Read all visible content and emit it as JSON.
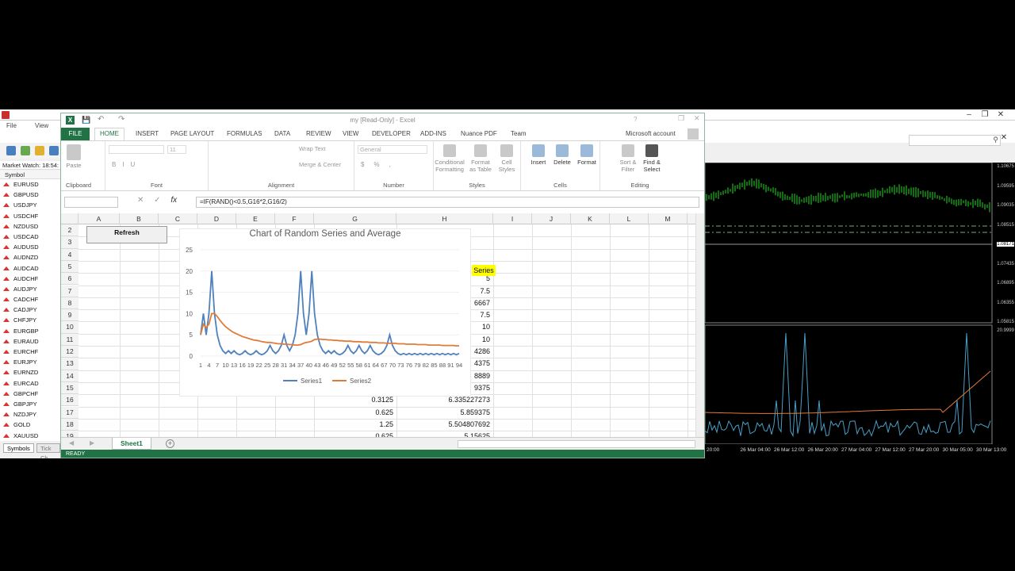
{
  "mt": {
    "menu": [
      "File",
      "View"
    ],
    "market_watch_header": "Market Watch: 18:54:",
    "symbol_col": "Symbol",
    "symbols": [
      "EURUSD",
      "GBPUSD",
      "USDJPY",
      "USDCHF",
      "NZDUSD",
      "USDCAD",
      "AUDUSD",
      "AUDNZD",
      "AUDCAD",
      "AUDCHF",
      "AUDJPY",
      "CADCHF",
      "CADJPY",
      "CHFJPY",
      "EURGBP",
      "EURAUD",
      "EURCHF",
      "EURJPY",
      "EURNZD",
      "EURCAD",
      "GBPCHF",
      "GBPJPY",
      "NZDJPY",
      "GOLD",
      "XAUUSD"
    ],
    "tabs": [
      "Symbols",
      "Tick Ch"
    ],
    "price_scale_top": [
      "1.10675",
      "1.09595",
      "1.09035",
      "1.08515",
      "1.08171",
      "1.07435",
      "1.06895",
      "1.06355",
      "1.05815"
    ],
    "price_scale_bottom": [
      "20.9999"
    ],
    "time_axis": [
      "20:00",
      "26 Mar 04:00",
      "26 Mar 12:00",
      "26 Mar 20:00",
      "27 Mar 04:00",
      "27 Mar 12:00",
      "27 Mar 20:00",
      "30 Mar 05:00",
      "30 Mar 13:00"
    ]
  },
  "excel": {
    "title": "my [Read-Only] - Excel",
    "account": "Microsoft account",
    "tabs": [
      "FILE",
      "HOME",
      "INSERT",
      "PAGE LAYOUT",
      "FORMULAS",
      "DATA",
      "REVIEW",
      "VIEW",
      "DEVELOPER",
      "ADD-INS",
      "Nuance PDF",
      "Team"
    ],
    "ribbon": {
      "clipboard": "Clipboard",
      "paste": "Paste",
      "font": "Font",
      "font_size": "11",
      "alignment": "Alignment",
      "wrap": "Wrap Text",
      "merge": "Merge & Center",
      "number": "Number",
      "number_format": "General",
      "styles": "Styles",
      "cond": "Conditional Formatting",
      "fmt_table": "Format as Table",
      "cell_styles": "Cell Styles",
      "cells": "Cells",
      "insert": "Insert",
      "delete": "Delete",
      "format": "Format",
      "editing": "Editing",
      "sort": "Sort & Filter",
      "find": "Find & Select"
    },
    "formula": "=IF(RAND()<0.5,G16*2,G16/2)",
    "columns": [
      "A",
      "B",
      "C",
      "D",
      "E",
      "F",
      "G",
      "H",
      "I",
      "J",
      "K",
      "L",
      "M"
    ],
    "rows": [
      "2",
      "3",
      "4",
      "5",
      "6",
      "7",
      "8",
      "9",
      "10",
      "11",
      "12",
      "13",
      "14",
      "15",
      "16",
      "17",
      "18",
      "19"
    ],
    "refresh_label": "Refresh",
    "series_header": "Series",
    "col_h_values": [
      "5",
      "7.5",
      "6667",
      "7.5",
      "10",
      "10",
      "4286",
      "4375",
      "8889",
      "9375",
      "6.335227273",
      "5.859375",
      "5.504807692",
      "5.15625"
    ],
    "col_g_values": [
      "0.3125",
      "0.625",
      "1.25",
      "0.625"
    ],
    "sheet_tab": "Sheet1",
    "status": "READY"
  },
  "chart_data": {
    "type": "line",
    "title": "Chart of Random Series and Average",
    "x_tick_labels": [
      "1",
      "4",
      "7",
      "10",
      "13",
      "16",
      "19",
      "22",
      "25",
      "28",
      "31",
      "34",
      "37",
      "40",
      "43",
      "46",
      "49",
      "52",
      "55",
      "58",
      "61",
      "64",
      "67",
      "70",
      "73",
      "76",
      "79",
      "82",
      "85",
      "88",
      "91",
      "94"
    ],
    "y_ticks": [
      "0",
      "5",
      "10",
      "15",
      "20",
      "25"
    ],
    "ylim": [
      0,
      25
    ],
    "series": [
      {
        "name": "Series1",
        "color": "#4f81bd",
        "values": [
          5,
          10,
          5,
          10,
          20,
          10,
          5,
          2.5,
          1.25,
          0.625,
          1.25,
          0.625,
          1.25,
          0.625,
          0.3125,
          0.625,
          1.25,
          0.625,
          0.3125,
          0.625,
          1.25,
          0.625,
          0.3125,
          0.625,
          1.25,
          2.5,
          1.25,
          0.625,
          1.25,
          2.5,
          5,
          2.5,
          1.25,
          2.5,
          5,
          10,
          20,
          10,
          5,
          10,
          20,
          10,
          5,
          2.5,
          1.25,
          0.625,
          1.25,
          0.625,
          1.25,
          0.625,
          0.3125,
          0.625,
          1.25,
          2.5,
          1.25,
          0.625,
          1.25,
          2.5,
          1.25,
          0.625,
          1.25,
          2.5,
          1.25,
          0.625,
          0.3125,
          0.625,
          1.25,
          2.5,
          5,
          2.5,
          1.25,
          0.625,
          0.3125,
          0.625,
          0.3125,
          0.625,
          0.3125,
          0.625,
          0.3125,
          0.625,
          0.3125,
          0.625,
          0.3125,
          0.625,
          0.3125,
          0.625,
          0.3125,
          0.625,
          0.3125,
          0.625,
          0.3125,
          0.625,
          0.3125,
          0.625
        ]
      },
      {
        "name": "Series2",
        "color": "#e07b39",
        "values": [
          5,
          7.5,
          6.7,
          7.5,
          10,
          10,
          9.3,
          8.4,
          7.6,
          6.9,
          6.4,
          5.9,
          5.5,
          5.2,
          4.9,
          4.6,
          4.4,
          4.2,
          4.0,
          3.8,
          3.7,
          3.6,
          3.4,
          3.3,
          3.2,
          3.2,
          3.1,
          3.0,
          2.9,
          2.9,
          2.8,
          2.8,
          2.7,
          2.7,
          2.6,
          2.6,
          2.7,
          3.0,
          3.2,
          3.3,
          3.5,
          3.9,
          4.0,
          4.0,
          3.9,
          3.9,
          3.8,
          3.8,
          3.7,
          3.7,
          3.6,
          3.6,
          3.5,
          3.5,
          3.5,
          3.4,
          3.4,
          3.4,
          3.3,
          3.3,
          3.3,
          3.2,
          3.2,
          3.2,
          3.1,
          3.1,
          3.1,
          3.0,
          3.0,
          3.0,
          3.0,
          2.9,
          2.9,
          2.9,
          2.8,
          2.8,
          2.8,
          2.8,
          2.7,
          2.7,
          2.7,
          2.7,
          2.6,
          2.6,
          2.6,
          2.6,
          2.6,
          2.5,
          2.5,
          2.5,
          2.5,
          2.5,
          2.4,
          2.4
        ]
      }
    ],
    "legend": "bottom"
  }
}
